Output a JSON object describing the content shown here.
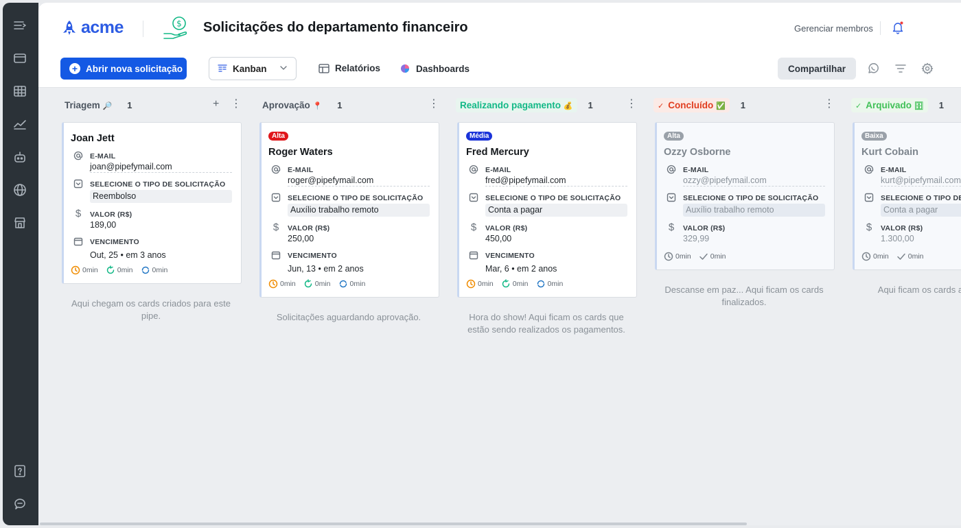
{
  "app": {
    "logo_text": "acme",
    "pipe_title": "Solicitações do departamento financeiro",
    "manage_members": "Gerenciar membros"
  },
  "toolbar": {
    "new_request": "Abrir nova solicitação",
    "view_select": "Kanban",
    "reports": "Relatórios",
    "dashboards": "Dashboards",
    "share": "Compartilhar"
  },
  "colors": {
    "brand": "#2c5be3",
    "primary_button": "#1459e4",
    "sidebar": "#2b3238",
    "badge_alta": "#e0161b",
    "badge_media": "#1a33d9",
    "badge_muted": "#9aa1a9",
    "success_green": "#12b886",
    "done_red": "#e03d1f"
  },
  "columns": [
    {
      "title": "Triagem",
      "emoji": "🔎",
      "count": "1",
      "description": "Aqui chegam os cards criados para este pipe.",
      "cards": [
        {
          "badge": "",
          "name": "Joan Jett",
          "email_label": "E-MAIL",
          "email": "joan@pipefymail.com",
          "type_label": "SELECIONE O TIPO DE SOLICITAÇÃO",
          "type": "Reembolso",
          "value_label": "VALOR (R$)",
          "value": "189,00",
          "due_label": "VENCIMENTO",
          "due": "Out, 25 • em 3 anos",
          "t1": "0min",
          "t2": "0min",
          "t3": "0min"
        }
      ]
    },
    {
      "title": "Aprovação",
      "emoji": "📍",
      "count": "1",
      "description": "Solicitações aguardando aprovação.",
      "cards": [
        {
          "badge": "Alta",
          "name": "Roger Waters",
          "email_label": "E-MAIL",
          "email": "roger@pipefymail.com",
          "type_label": "SELECIONE O TIPO DE SOLICITAÇÃO",
          "type": "Auxílio trabalho remoto",
          "value_label": "VALOR (R$)",
          "value": "250,00",
          "due_label": "VENCIMENTO",
          "due": "Jun, 13 • em 2 anos",
          "t1": "0min",
          "t2": "0min",
          "t3": "0min"
        }
      ]
    },
    {
      "title": "Realizando pagamento",
      "emoji": "💰",
      "count": "1",
      "description": "Hora do show! Aqui ficam os cards que estão sendo realizados os pagamentos.",
      "cards": [
        {
          "badge": "Média",
          "name": "Fred Mercury",
          "email_label": "E-MAIL",
          "email": "fred@pipefymail.com",
          "type_label": "SELECIONE O TIPO DE SOLICITAÇÃO",
          "type": "Conta a pagar",
          "value_label": "VALOR (R$)",
          "value": "450,00",
          "due_label": "VENCIMENTO",
          "due": "Mar, 6 • em 2 anos",
          "t1": "0min",
          "t2": "0min",
          "t3": "0min"
        }
      ]
    },
    {
      "title": "Concluído",
      "emoji": "✅",
      "count": "1",
      "description": "Descanse em paz... Aqui ficam os cards finalizados.",
      "cards": [
        {
          "badge": "Alta",
          "name": "Ozzy Osborne",
          "email_label": "E-MAIL",
          "email": "ozzy@pipefymail.com",
          "type_label": "SELECIONE O TIPO DE SOLICITAÇÃO",
          "type": "Auxílio trabalho remoto",
          "value_label": "VALOR (R$)",
          "value": "329,99",
          "t1": "0min",
          "t2": "0min"
        }
      ]
    },
    {
      "title": "Arquivado",
      "emoji": "🗄",
      "count": "1",
      "description": "Aqui ficam os cards a reprovado",
      "cards": [
        {
          "badge": "Baixa",
          "name": "Kurt Cobain",
          "email_label": "E-MAIL",
          "email": "kurt@pipefymail.com",
          "type_label": "SELECIONE O TIPO DE S",
          "type": "Conta a pagar",
          "value_label": "VALOR (R$)",
          "value": "1.300,00",
          "t1": "0min",
          "t2": "0min"
        }
      ]
    }
  ]
}
